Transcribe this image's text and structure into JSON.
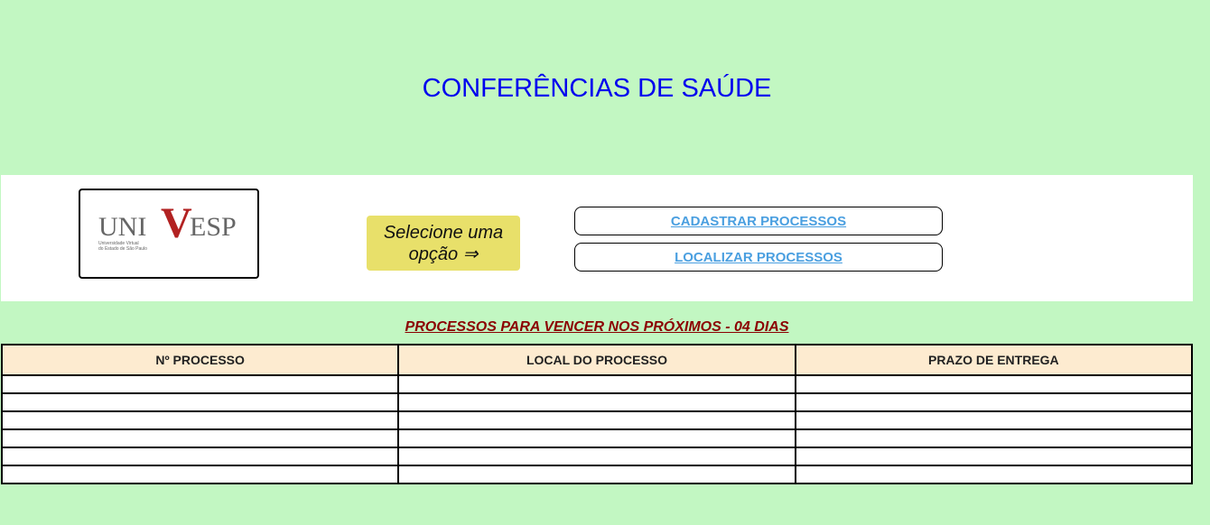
{
  "header": {
    "title": "CONFERÊNCIAS DE SAÚDE"
  },
  "logo": {
    "brand_left": "UNI",
    "brand_v": "V",
    "brand_right": "ESP",
    "caption_line1": "Universidade Virtual",
    "caption_line2": "do Estado de São Paulo",
    "accent_color": "#b22222"
  },
  "options": {
    "hint": "Selecione uma opção ⇒",
    "register_label": "CADASTRAR PROCESSOS",
    "search_label": "LOCALIZAR PROCESSOS"
  },
  "table": {
    "caption": "PROCESSOS PARA VENCER NOS PRÓXIMOS - 04 DIAS",
    "columns": [
      "Nº PROCESSO",
      "LOCAL DO PROCESSO",
      "PRAZO DE ENTREGA"
    ],
    "rows": [
      [
        "",
        "",
        ""
      ],
      [
        "",
        "",
        ""
      ],
      [
        "",
        "",
        ""
      ],
      [
        "",
        "",
        ""
      ],
      [
        "",
        "",
        ""
      ],
      [
        "",
        "",
        ""
      ]
    ]
  },
  "colors": {
    "background": "#c2f7c2",
    "title": "#0000ee",
    "hint_bg": "#e8e06a",
    "link": "#4a9fe0",
    "caption": "#8b0000",
    "table_header_bg": "#fdebd0"
  }
}
